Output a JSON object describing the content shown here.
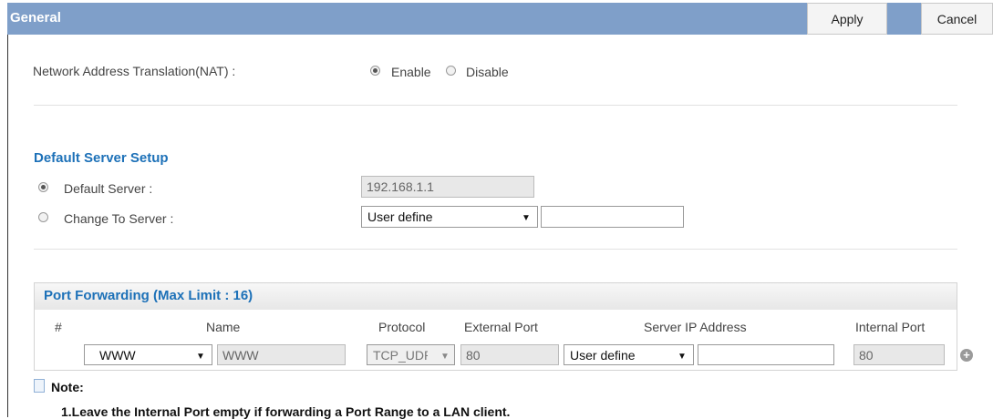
{
  "header": {
    "title": "General",
    "apply_label": "Apply",
    "cancel_label": "Cancel"
  },
  "nat": {
    "label": "Network Address Translation(NAT) :",
    "enable_label": "Enable",
    "disable_label": "Disable",
    "selected": "Enable"
  },
  "default_server": {
    "title": "Default Server Setup",
    "default_server_label": "Default Server :",
    "default_server_value": "192.168.1.1",
    "change_to_label": "Change To Server :",
    "change_to_select": "User define",
    "change_to_input": "",
    "selected": "Default Server"
  },
  "port_forwarding": {
    "title": "Port Forwarding (Max Limit : 16)",
    "columns": [
      "#",
      "Name",
      "Protocol",
      "External Port",
      "Server IP Address",
      "Internal Port"
    ],
    "row": {
      "name_select": "WWW",
      "name_value": "WWW",
      "protocol": "TCP_UDP",
      "external_port": "80",
      "server_ip_select": "User define",
      "server_ip_input": "",
      "internal_port": "80"
    }
  },
  "note": {
    "title": "Note:",
    "line1": "1.Leave the Internal Port empty if forwarding a Port Range to a LAN client."
  }
}
